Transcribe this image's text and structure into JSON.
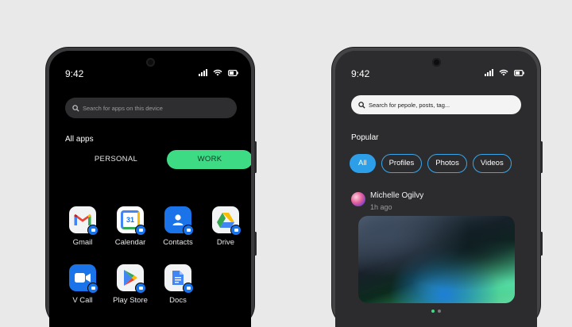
{
  "personal_phone": {
    "time": "9:42",
    "search_placeholder": "Search for apps on this device",
    "section_title": "All apps",
    "tabs": [
      {
        "label": "PERSONAL",
        "selected": false
      },
      {
        "label": "WORK",
        "selected": true
      }
    ],
    "apps": [
      {
        "label": "Gmail",
        "icon": "gmail-icon"
      },
      {
        "label": "Calendar",
        "icon": "calendar-icon",
        "icon_text": "31"
      },
      {
        "label": "Contacts",
        "icon": "contacts-icon"
      },
      {
        "label": "Drive",
        "icon": "drive-icon"
      },
      {
        "label": "V Call",
        "icon": "video-call-icon"
      },
      {
        "label": "Play Store",
        "icon": "play-store-icon"
      },
      {
        "label": "Docs",
        "icon": "docs-icon"
      }
    ],
    "accent_color": "#3ddc84",
    "work_badge_color": "#1a73e8"
  },
  "social_phone": {
    "time": "9:42",
    "search_placeholder": "Search for pepole, posts, tag...",
    "section_title": "Popular",
    "filters": [
      {
        "label": "All",
        "selected": true
      },
      {
        "label": "Profiles",
        "selected": false
      },
      {
        "label": "Photos",
        "selected": false
      },
      {
        "label": "Videos",
        "selected": false
      }
    ],
    "post": {
      "author": "Michelle Ogilvy",
      "time_ago": "1h ago",
      "carousel_pages": 2,
      "carousel_active_page": 1
    },
    "accent_color": "#2d9fe8"
  }
}
